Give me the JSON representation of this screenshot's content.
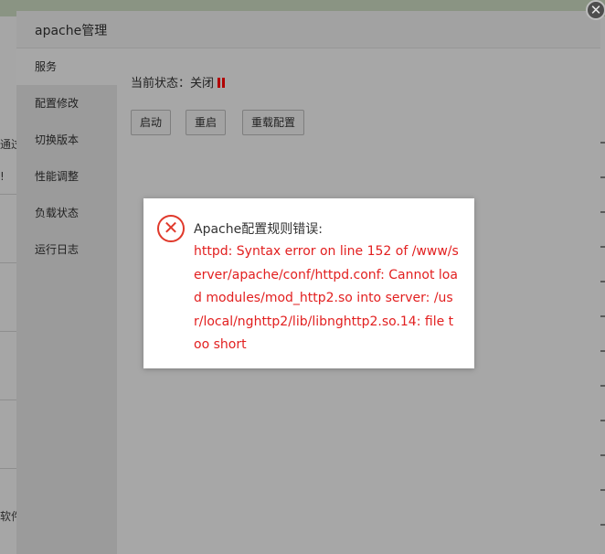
{
  "background": {
    "fragments": [
      "通过",
      "!",
      "软件"
    ]
  },
  "modal": {
    "title": "apache管理",
    "close_glyph": "✕",
    "sidebar": {
      "items": [
        {
          "label": "服务",
          "active": true
        },
        {
          "label": "配置修改"
        },
        {
          "label": "切换版本"
        },
        {
          "label": "性能调整"
        },
        {
          "label": "负载状态"
        },
        {
          "label": "运行日志"
        }
      ]
    },
    "service": {
      "status_label": "当前状态：关闭",
      "status_icon": "pause-icon",
      "status_color": "#b10000",
      "buttons": {
        "start": "启动",
        "restart": "重启",
        "reload": "重载配置"
      }
    }
  },
  "error_dialog": {
    "icon": "error-x-icon",
    "icon_color": "#e0392b",
    "title": "Apache配置规则错误:",
    "message": "httpd: Syntax error on line 152 of /www/server/apache/conf/httpd.conf: Cannot load modules/mod_http2.so into server: /usr/local/nghttp2/lib/libnghttp2.so.14: file too short",
    "message_color": "#e21f1f"
  }
}
